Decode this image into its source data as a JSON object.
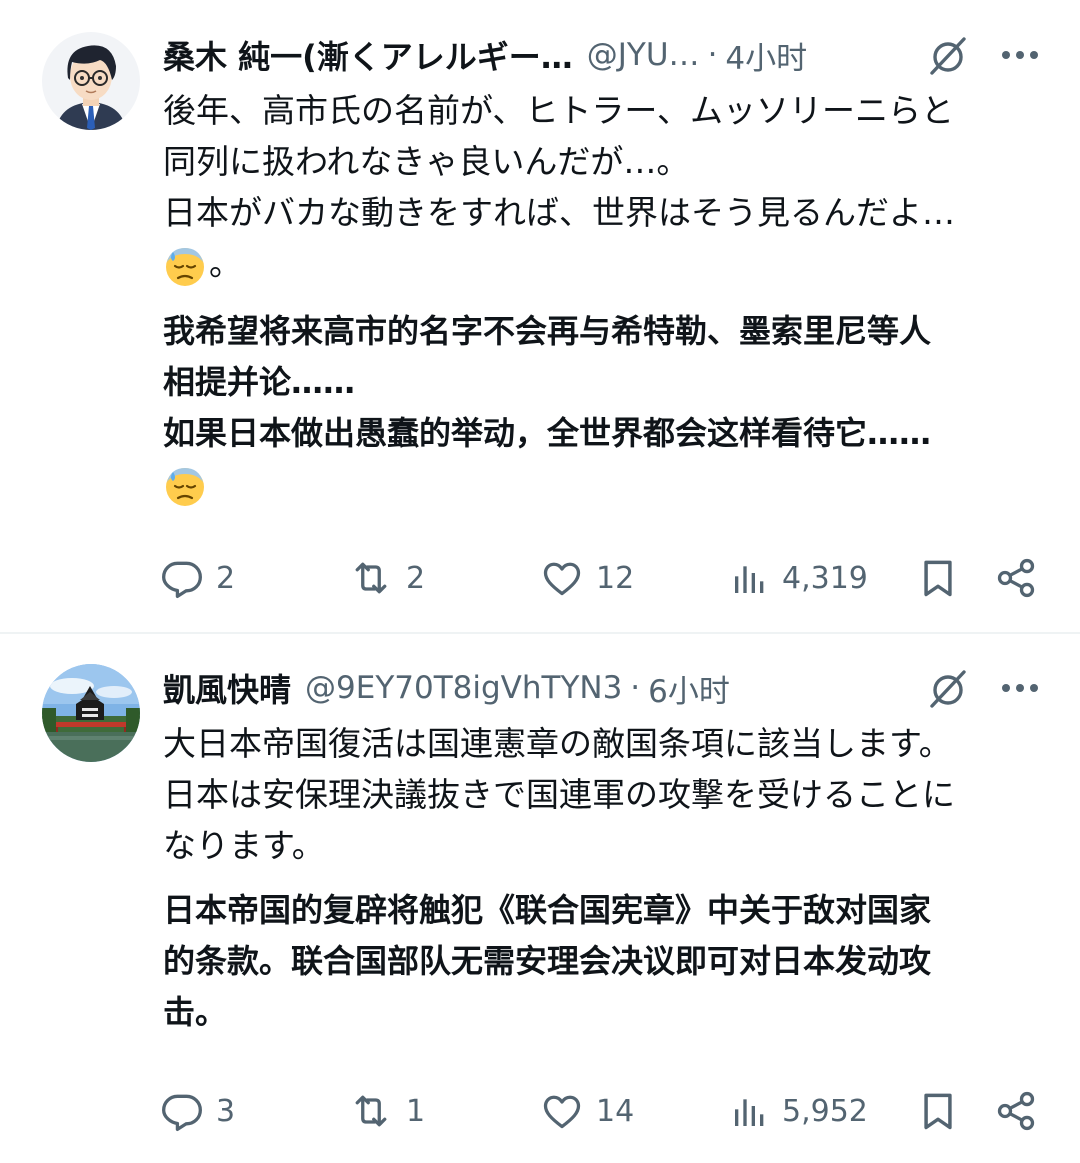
{
  "tweets": [
    {
      "author": {
        "name": "桑木 純一(漸くアレルギー…",
        "handle": "@JYU…",
        "time": "4小时"
      },
      "text_lines": [
        "後年、高市氏の名前が、ヒトラー、ムッソリーニらと",
        "同列に扱われなきゃ良いんだが…。",
        "日本がバカな動きをすれば、世界はそう見るんだよ…"
      ],
      "text_tail": "。",
      "translation_lines": [
        "我希望将来高市的名字不会再与希特勒、墨索里尼等人",
        "相提并论……",
        "如果日本做出愚蠢的举动，全世界都会这样看待它……"
      ],
      "stats": {
        "replies": "2",
        "reposts": "2",
        "likes": "12",
        "views": "4,319"
      }
    },
    {
      "author": {
        "name": "凱風快晴",
        "handle": "@9EY70T8igVhTYN3",
        "time": "6小时"
      },
      "text_lines": [
        "大日本帝国復活は国連憲章の敵国条項に該当します。",
        "日本は安保理決議抜きで国連軍の攻撃を受けることに",
        "なります。"
      ],
      "translation_lines": [
        "日本帝国的复辟将触犯《联合国宪章》中关于敌对国家",
        "的条款。联合国部队无需安理会决议即可对日本发动攻",
        "击。"
      ],
      "stats": {
        "replies": "3",
        "reposts": "1",
        "likes": "14",
        "views": "5,952"
      }
    }
  ],
  "icons": {
    "header": [
      "grok-icon",
      "more-icon"
    ],
    "actions": [
      "reply-icon",
      "repost-icon",
      "like-icon",
      "views-icon",
      "bookmark-icon",
      "share-icon"
    ],
    "emoji": "downcast-face-with-sweat-emoji"
  },
  "colors": {
    "text": "#0f1419",
    "secondary": "#536471",
    "divider": "#eff3f4",
    "background": "#ffffff"
  }
}
